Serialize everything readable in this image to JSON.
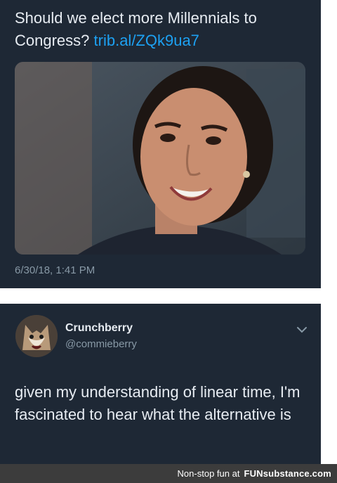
{
  "top_tweet": {
    "text": "Should we elect more Millennials to Congress?",
    "link": "trib.al/ZQk9ua7",
    "timestamp": "6/30/18, 1:41 PM"
  },
  "reply_tweet": {
    "display_name": "Crunchberry",
    "handle": "@commieberry",
    "text": "given my understanding of linear time, I'm fascinated to hear what the alternative is"
  },
  "footer": {
    "tagline": "Non-stop fun at",
    "brand": "FUNsubstance.com"
  },
  "colors": {
    "card_bg": "#1e2835",
    "link": "#1da1f2",
    "muted": "#8899a6"
  }
}
